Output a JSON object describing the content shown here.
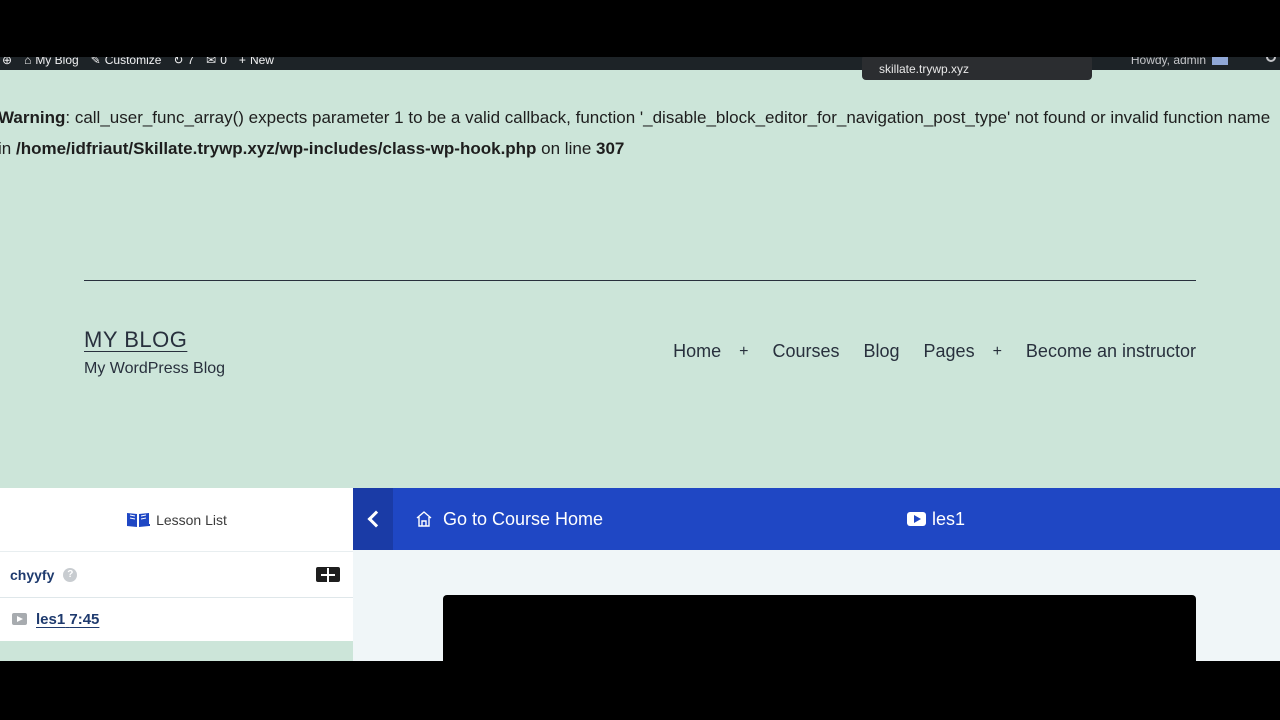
{
  "admin_bar": {
    "site_name": "My Blog",
    "customize": "Customize",
    "updates_count": "7",
    "comments_count": "0",
    "new_label": "New",
    "howdy": "Howdy, admin"
  },
  "tooltip": {
    "text": "skillate.trywp.xyz"
  },
  "warning": {
    "label": "Warning",
    "message": ": call_user_func_array() expects parameter 1 to be a valid callback, function '_disable_block_editor_for_navigation_post_type' not found or invalid function name in ",
    "path": "/home/idfriaut/Skillate.trywp.xyz/wp-includes/class-wp-hook.php",
    "line_text": " on line ",
    "line_number": "307"
  },
  "site": {
    "title": "MY BLOG",
    "description": "My WordPress Blog"
  },
  "nav": {
    "home": "Home",
    "plus": "+",
    "courses": "Courses",
    "blog": "Blog",
    "pages": "Pages",
    "become_instructor": "Become an instructor"
  },
  "lesson_sidebar": {
    "header": "Lesson List",
    "topic_title": "chyyfy",
    "help": "?",
    "lesson_title": "les1",
    "lesson_duration": "7:45"
  },
  "lesson_topbar": {
    "course_home": "Go to Course Home",
    "current_lesson": "les1"
  },
  "colors": {
    "page_bg": "#cce5d9",
    "topbar_bg": "#1f47c4",
    "admin_bar_bg": "#1d2327"
  }
}
